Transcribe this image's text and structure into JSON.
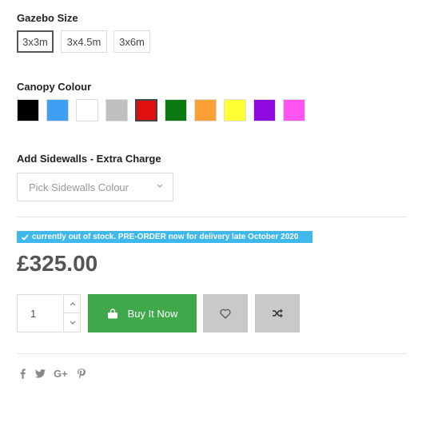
{
  "gazebo_size": {
    "label": "Gazebo Size",
    "options": [
      "3x3m",
      "3x4.5m",
      "3x6m"
    ],
    "selected": "3x3m"
  },
  "canopy_colour": {
    "label": "Canopy Colour",
    "swatches": [
      "#000000",
      "#3e9ff5",
      "#ffffff",
      "#bfbfbf",
      "#e01010",
      "#0b7a12",
      "#f9a137",
      "#ffff33",
      "#8f08e0",
      "#ff55ee"
    ],
    "selected_index": 4
  },
  "sidewalls": {
    "label": "Add Sidewalls - Extra Charge",
    "placeholder": "Pick Sidewalls Colour"
  },
  "stock_notice": "currently out of stock. PRE-ORDER now for delivery late October 2020",
  "price": "£325.00",
  "quantity": "1",
  "buy_label": "Buy It Now",
  "colors": {
    "buy_button": "#3ea84a",
    "stock_badge": "#3fb8ec",
    "icon_button": "#c9c9c9"
  },
  "icons": {
    "buy": "shopping-bag-icon",
    "wishlist": "heart-icon",
    "compare": "shuffle-icon",
    "social": [
      "facebook-icon",
      "twitter-icon",
      "google-plus-icon",
      "pinterest-icon"
    ]
  }
}
